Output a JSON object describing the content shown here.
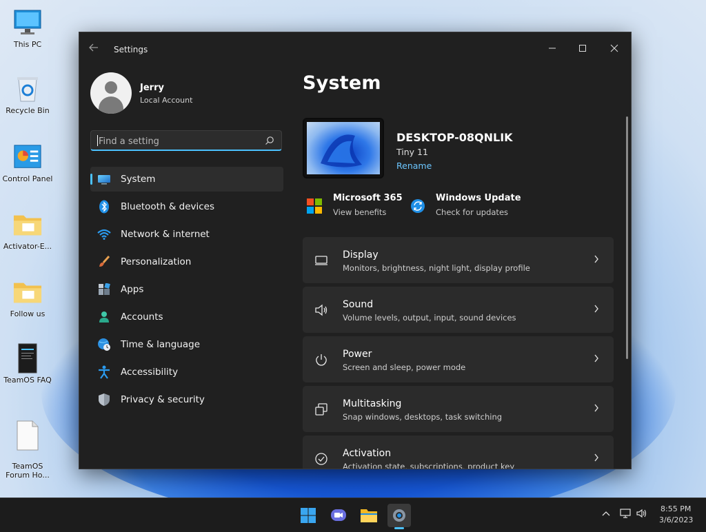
{
  "desktop": {
    "icons": [
      {
        "label": "This PC"
      },
      {
        "label": "Recycle Bin"
      },
      {
        "label": "Control Panel"
      },
      {
        "label": "Activator-E..."
      },
      {
        "label": "Follow us"
      },
      {
        "label": "TeamOS FAQ"
      },
      {
        "label": "TeamOS\nForum Ho..."
      }
    ]
  },
  "window": {
    "title": "Settings",
    "back_icon": "back-arrow-icon",
    "caption": {
      "minimize": "minimize-icon",
      "maximize": "maximize-icon",
      "close": "close-icon"
    }
  },
  "profile": {
    "name": "Jerry",
    "account_type": "Local Account"
  },
  "search": {
    "placeholder": "Find a setting",
    "value": ""
  },
  "nav": {
    "items": [
      {
        "label": "System",
        "icon": "system-icon",
        "active": true
      },
      {
        "label": "Bluetooth & devices",
        "icon": "bluetooth-icon"
      },
      {
        "label": "Network & internet",
        "icon": "wifi-icon"
      },
      {
        "label": "Personalization",
        "icon": "brush-icon"
      },
      {
        "label": "Apps",
        "icon": "apps-icon"
      },
      {
        "label": "Accounts",
        "icon": "account-icon"
      },
      {
        "label": "Time & language",
        "icon": "globe-clock-icon"
      },
      {
        "label": "Accessibility",
        "icon": "accessibility-icon"
      },
      {
        "label": "Privacy & security",
        "icon": "shield-icon"
      }
    ]
  },
  "main": {
    "title": "System",
    "device": {
      "name": "DESKTOP-08QNLIK",
      "os": "Tiny 11",
      "rename_label": "Rename"
    },
    "quick_links": [
      {
        "title": "Microsoft 365",
        "subtitle": "View benefits",
        "icon": "microsoft-logo-icon"
      },
      {
        "title": "Windows Update",
        "subtitle": "Check for updates",
        "icon": "update-icon"
      }
    ],
    "cards": [
      {
        "title": "Display",
        "subtitle": "Monitors, brightness, night light, display profile",
        "icon": "display-icon"
      },
      {
        "title": "Sound",
        "subtitle": "Volume levels, output, input, sound devices",
        "icon": "speaker-icon"
      },
      {
        "title": "Power",
        "subtitle": "Screen and sleep, power mode",
        "icon": "power-icon"
      },
      {
        "title": "Multitasking",
        "subtitle": "Snap windows, desktops, task switching",
        "icon": "multitasking-icon"
      },
      {
        "title": "Activation",
        "subtitle": "Activation state, subscriptions, product key",
        "icon": "check-circle-icon"
      }
    ]
  },
  "taskbar": {
    "apps": [
      {
        "name": "start",
        "icon": "windows-logo-icon"
      },
      {
        "name": "teams",
        "icon": "teams-camera-icon"
      },
      {
        "name": "file-explorer",
        "icon": "folder-icon"
      },
      {
        "name": "settings",
        "icon": "settings-gear-icon"
      }
    ],
    "tray": {
      "time": "8:55 PM",
      "date": "3/6/2023"
    }
  },
  "colors": {
    "accent": "#4cc2ff",
    "window_bg": "#202020",
    "card_bg": "#2b2b2b",
    "link": "#6cc6ff"
  }
}
